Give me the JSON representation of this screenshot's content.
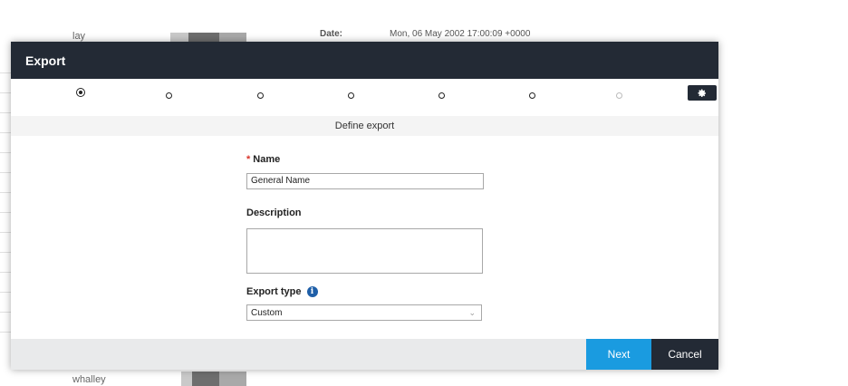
{
  "background": {
    "top_user": "lay",
    "bottom_user": "whalley",
    "header_label": "Date:",
    "header_value": "Mon, 06 May 2002 17:00:09 +0000"
  },
  "modal": {
    "title": "Export",
    "steps": [
      {
        "state": "active"
      },
      {
        "state": "pending"
      },
      {
        "state": "pending"
      },
      {
        "state": "pending"
      },
      {
        "state": "pending"
      },
      {
        "state": "pending"
      },
      {
        "state": "disabled"
      }
    ],
    "settings_icon": "gear-icon",
    "section_title": "Define export",
    "name": {
      "label": "Name",
      "required_marker": "*",
      "value": "General Name"
    },
    "description": {
      "label": "Description",
      "value": ""
    },
    "export_type": {
      "label": "Export type",
      "info_icon": "info-icon",
      "selected": "Custom"
    },
    "buttons": {
      "next": "Next",
      "cancel": "Cancel"
    }
  },
  "colors": {
    "header_bg": "#232a35",
    "primary": "#1a9be0",
    "required": "#d9342b",
    "info": "#1f5fa8"
  }
}
